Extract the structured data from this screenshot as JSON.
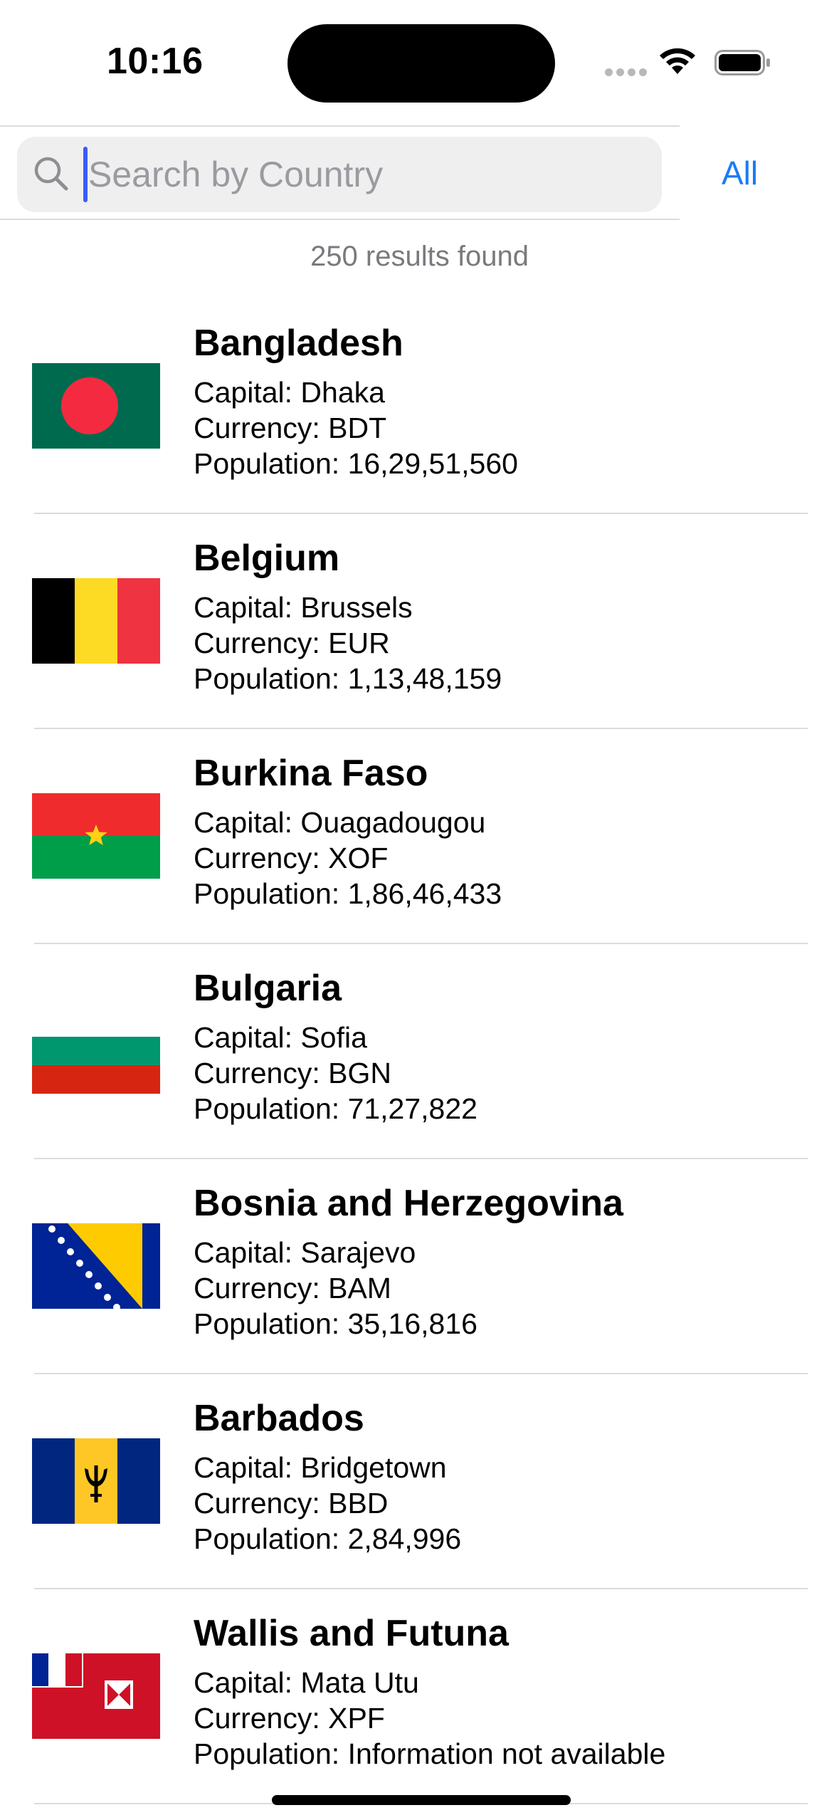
{
  "status_bar": {
    "time": "10:16"
  },
  "search": {
    "placeholder": "Search by Country",
    "value": "",
    "filter_label": "All"
  },
  "results_text": "250 results found",
  "labels": {
    "capital": "Capital: ",
    "currency": "Currency: ",
    "population": "Population: "
  },
  "countries": [
    {
      "name": "Bangladesh",
      "flag": "bangladesh-flag-icon",
      "capital": "Dhaka",
      "currency": "BDT",
      "population": "16,29,51,560"
    },
    {
      "name": "Belgium",
      "flag": "belgium-flag-icon",
      "capital": "Brussels",
      "currency": "EUR",
      "population": "1,13,48,159"
    },
    {
      "name": "Burkina Faso",
      "flag": "burkina-faso-flag-icon",
      "capital": "Ouagadougou",
      "currency": "XOF",
      "population": "1,86,46,433"
    },
    {
      "name": "Bulgaria",
      "flag": "bulgaria-flag-icon",
      "capital": "Sofia",
      "currency": "BGN",
      "population": "71,27,822"
    },
    {
      "name": "Bosnia and Herzegovina",
      "flag": "bosnia-flag-icon",
      "capital": "Sarajevo",
      "currency": "BAM",
      "population": "35,16,816"
    },
    {
      "name": "Barbados",
      "flag": "barbados-flag-icon",
      "capital": "Bridgetown",
      "currency": "BBD",
      "population": "2,84,996"
    },
    {
      "name": "Wallis and Futuna",
      "flag": "wallis-futuna-flag-icon",
      "capital": "Mata Utu",
      "currency": "XPF",
      "population": "Information not available"
    }
  ],
  "colors": {
    "accent": "#1a7cf5",
    "caret": "#3a5cff",
    "secondary_text": "#7a7a7e"
  }
}
